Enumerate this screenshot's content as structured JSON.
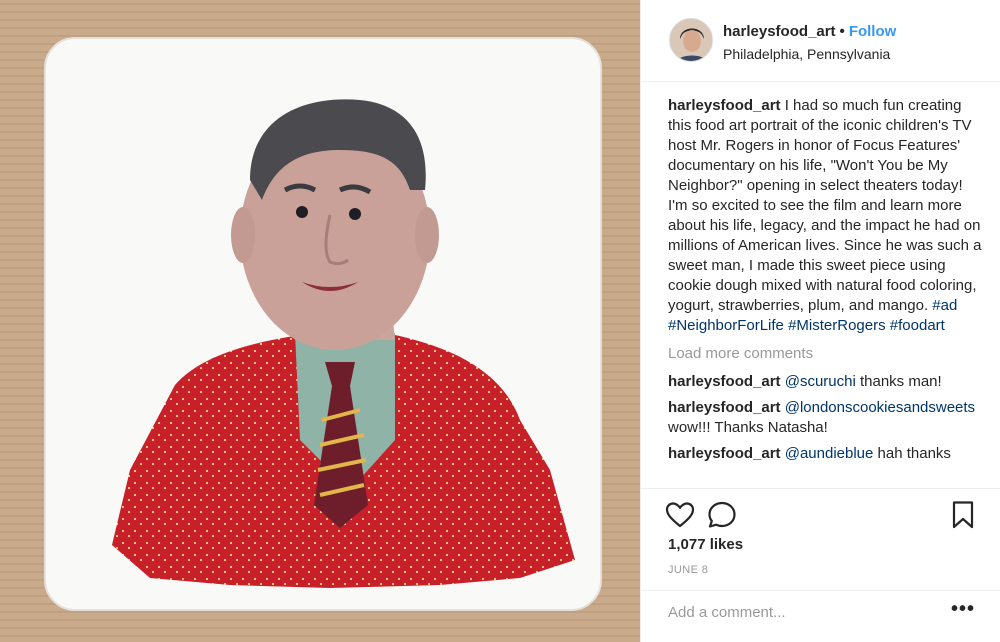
{
  "post": {
    "username": "harleysfood_art",
    "follow_label": "Follow",
    "location": "Philadelphia, Pennsylvania",
    "caption": {
      "username": "harleysfood_art",
      "text": "I had so much fun creating this food art portrait of the iconic children's TV host Mr. Rogers in honor of Focus Features' documentary on his life, \"Won't You be My Neighbor?\" opening in select theaters today! I'm so excited to see the film and learn more about his life, legacy, and the impact he had on millions of American lives. Since he was such a sweet man, I made this sweet piece using cookie dough mixed with natural food coloring, yogurt, strawberries, plum, and mango.",
      "hashtags": [
        "#ad",
        "#NeighborForLife",
        "#MisterRogers",
        "#foodart"
      ]
    },
    "load_more_label": "Load more comments",
    "comments": [
      {
        "username": "harleysfood_art",
        "mention": "@scuruchi",
        "text": "thanks man!"
      },
      {
        "username": "harleysfood_art",
        "mention": "@londonscookiesandsweets",
        "text": "wow!!! Thanks Natasha!"
      },
      {
        "username": "harleysfood_art",
        "mention": "@aundieblue",
        "text": "hah thanks"
      }
    ],
    "likes": "1,077 likes",
    "date": "JUNE 8",
    "add_comment_placeholder": "Add a comment...",
    "more_label": "•••"
  },
  "icons": {
    "like": "heart-icon",
    "comment": "comment-bubble-icon",
    "save": "bookmark-icon",
    "more": "more-options-icon"
  },
  "colors": {
    "follow": "#3897f0",
    "hashtag": "#003569",
    "muted": "#999999",
    "text": "#262626"
  }
}
